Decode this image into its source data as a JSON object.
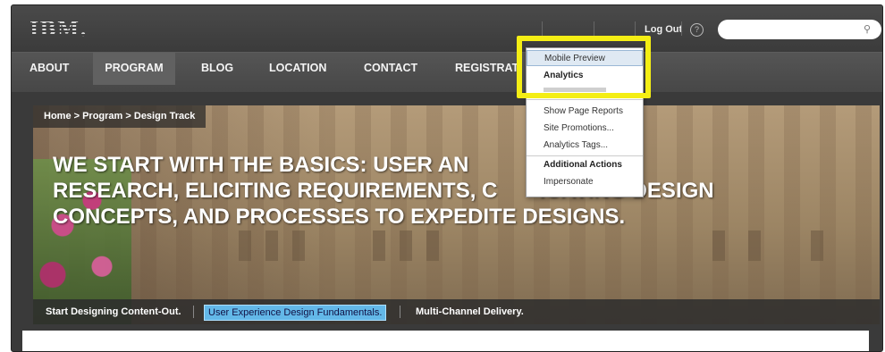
{
  "header": {
    "logo": "IBM.",
    "util": [
      "Log Out"
    ],
    "search_placeholder": ""
  },
  "nav": {
    "items": [
      "ABOUT",
      "PROGRAM",
      "BLOG",
      "LOCATION",
      "CONTACT",
      "REGISTRAT"
    ]
  },
  "hero": {
    "breadcrumb": "Home > Program > Design Track",
    "headline_lines": [
      "WE START WITH THE BASICS: USER AN          TITIVE",
      "RESEARCH, ELICITING REQUIREMENTS, C       ICATING DESIGN",
      "CONCEPTS, AND PROCESSES TO EXPEDITE DESIGNS."
    ],
    "tags": [
      "Start Designing Content-Out.",
      "User Experience Design Fundamentals.",
      "Multi-Channel Delivery."
    ]
  },
  "dropdown": {
    "items": [
      "Mobile Preview",
      "Analytics",
      "Show Page Reports",
      "Site Promotions...",
      "Analytics Tags...",
      "Additional Actions",
      "Impersonate"
    ]
  },
  "colors": {
    "highlight": "#f4ee14",
    "selected_tag": "#63b8e8"
  }
}
